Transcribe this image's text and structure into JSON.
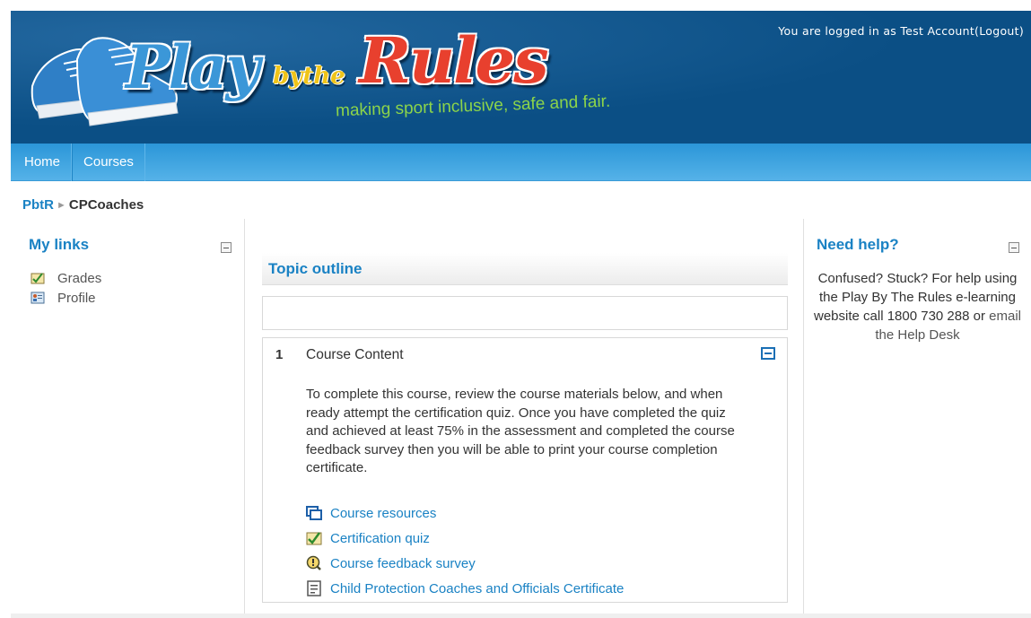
{
  "header": {
    "logo": {
      "play": "Play",
      "bythe": "bythe",
      "rules": "Rules",
      "tagline": "making sport inclusive, safe and fair."
    },
    "login_prefix": "You are logged in as Test Account",
    "logout_label": "(Logout)"
  },
  "nav": {
    "items": [
      {
        "label": "Home"
      },
      {
        "label": "Courses"
      }
    ]
  },
  "breadcrumb": {
    "root": "PbtR",
    "separator": "►",
    "current": "CPCoaches"
  },
  "left_block": {
    "title": "My links",
    "items": [
      {
        "label": "Grades",
        "icon": "grades-icon"
      },
      {
        "label": "Profile",
        "icon": "profile-icon"
      }
    ]
  },
  "main": {
    "title": "Topic outline",
    "section": {
      "number": "1",
      "title": "Course Content",
      "summary": "To complete this course, review the course materials below, and when ready attempt the certification quiz. Once you have completed the quiz and achieved at least 75% in the assessment and completed the course feedback survey then you will be able to print your course completion certificate.",
      "activities": [
        {
          "label": "Course resources",
          "icon": "resource-icon"
        },
        {
          "label": "Certification quiz",
          "icon": "quiz-icon"
        },
        {
          "label": "Course feedback survey",
          "icon": "survey-icon"
        },
        {
          "label": "Child Protection Coaches and Officials Certificate",
          "icon": "certificate-icon"
        }
      ]
    }
  },
  "right_block": {
    "title": "Need help?",
    "text_before": "Confused? Stuck? For help using the Play By The Rules e-learning website call 1800 730 288 or ",
    "link": "email the Help Desk"
  },
  "colors": {
    "header_bg": "#0b4f85",
    "nav_bg": "#3aa2e0",
    "link": "#1a82c4",
    "accent_red": "#e8402e",
    "accent_green": "#8cd44a"
  }
}
